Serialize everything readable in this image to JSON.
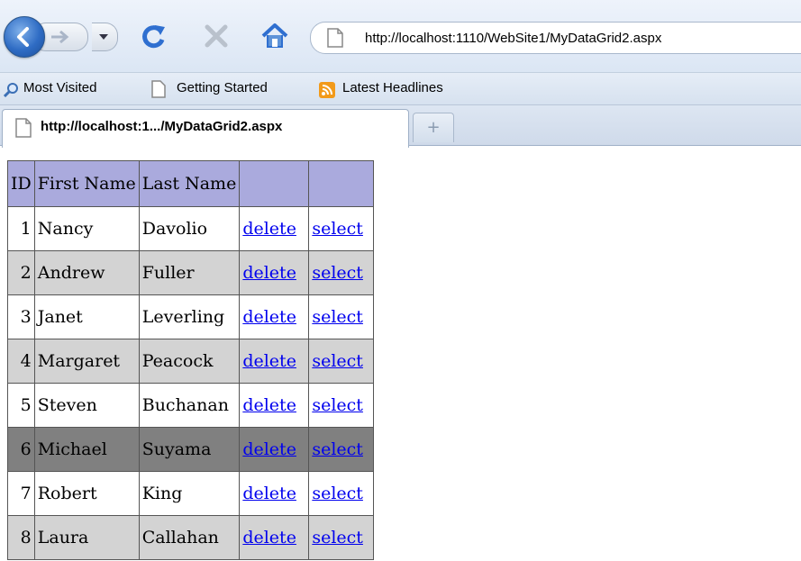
{
  "browser": {
    "url": "http://localhost:1110/WebSite1/MyDataGrid2.aspx",
    "bookmarks": [
      "Most Visited",
      "Getting Started",
      "Latest Headlines"
    ],
    "tab_title": "http://localhost:1.../MyDataGrid2.aspx",
    "icons": {
      "back": "back-arrow-icon",
      "forward": "forward-arrow-icon",
      "history": "chevron-down-icon",
      "reload": "reload-icon",
      "stop": "stop-icon",
      "home": "home-icon",
      "page": "page-icon",
      "rss": "rss-icon",
      "new_tab": "plus-icon"
    }
  },
  "grid": {
    "headers": [
      "ID",
      "First Name",
      "Last Name",
      "",
      ""
    ],
    "rows": [
      {
        "id": "1",
        "first": "Nancy",
        "last": "Davolio",
        "delete": "delete",
        "select": "select"
      },
      {
        "id": "2",
        "first": "Andrew",
        "last": "Fuller",
        "delete": "delete",
        "select": "select"
      },
      {
        "id": "3",
        "first": "Janet",
        "last": "Leverling",
        "delete": "delete",
        "select": "select"
      },
      {
        "id": "4",
        "first": "Margaret",
        "last": "Peacock",
        "delete": "delete",
        "select": "select"
      },
      {
        "id": "5",
        "first": "Steven",
        "last": "Buchanan",
        "delete": "delete",
        "select": "select"
      },
      {
        "id": "6",
        "first": "Michael",
        "last": "Suyama",
        "delete": "delete",
        "select": "select"
      },
      {
        "id": "7",
        "first": "Robert",
        "last": "King",
        "delete": "delete",
        "select": "select"
      },
      {
        "id": "8",
        "first": "Laura",
        "last": "Callahan",
        "delete": "delete",
        "select": "select"
      }
    ],
    "colors": {
      "header": "#aaaadd",
      "alternating_row": "#d3d3d3",
      "selected_row": "#808080",
      "link": "#0000ee"
    }
  }
}
